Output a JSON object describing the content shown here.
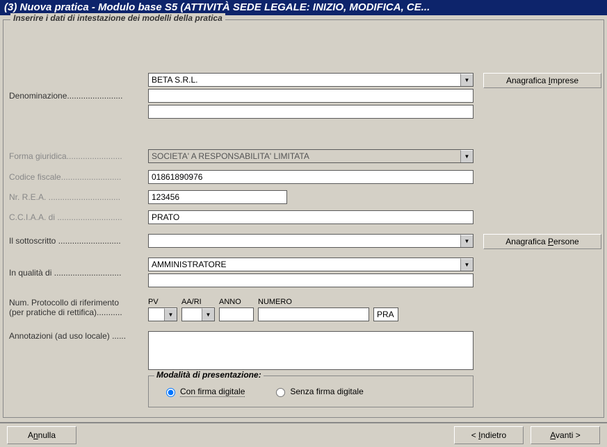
{
  "window": {
    "title": "(3) Nuova pratica - Modulo base S5 (ATTIVITÀ SEDE LEGALE: INIZIO, MODIFICA, CE..."
  },
  "fieldset": {
    "legend": "Inserire i dati di intestazione dei modelli della pratica"
  },
  "labels": {
    "denominazione": "Denominazione........................",
    "forma_giuridica": "Forma giuridica........................",
    "codice_fiscale": "Codice fiscale..........................",
    "nr_rea": "Nr. R.E.A. ...............................",
    "cciaa": "C.C.I.A.A. di ............................",
    "sottoscritto": "Il sottoscritto ...........................",
    "in_qualita": "In qualità di .............................",
    "protocollo": "Num. Protocollo di riferimento",
    "protocollo_sub": "(per pratiche di rettifica)...........",
    "annotazioni": "Annotazioni (ad uso locale) ......"
  },
  "fields": {
    "denominazione": "BETA S.R.L.",
    "denominazione2": "",
    "denominazione3": "",
    "forma_giuridica": "SOCIETA' A RESPONSABILITA' LIMITATA",
    "codice_fiscale": "01861890976",
    "nr_rea": "123456",
    "cciaa": "PRATO",
    "sottoscritto": "",
    "in_qualita": "AMMINISTRATORE",
    "in_qualita2": "",
    "annotazioni": ""
  },
  "protocollo": {
    "hdr_pv": "PV",
    "hdr_aari": "AA/RI",
    "hdr_anno": "ANNO",
    "hdr_numero": "NUMERO",
    "pv": "",
    "aari": "",
    "anno": "",
    "numero": "",
    "suffix": "PRA"
  },
  "presentation": {
    "legend": "Modalità di presentazione:",
    "opt1": "Con firma digitale",
    "opt2": "Senza firma digitale"
  },
  "buttons": {
    "anagrafica_imprese": "Anagrafica Imprese",
    "anagrafica_persone": "Anagrafica Persone",
    "annulla": "Annulla",
    "indietro": "< Indietro",
    "avanti": "Avanti >"
  }
}
